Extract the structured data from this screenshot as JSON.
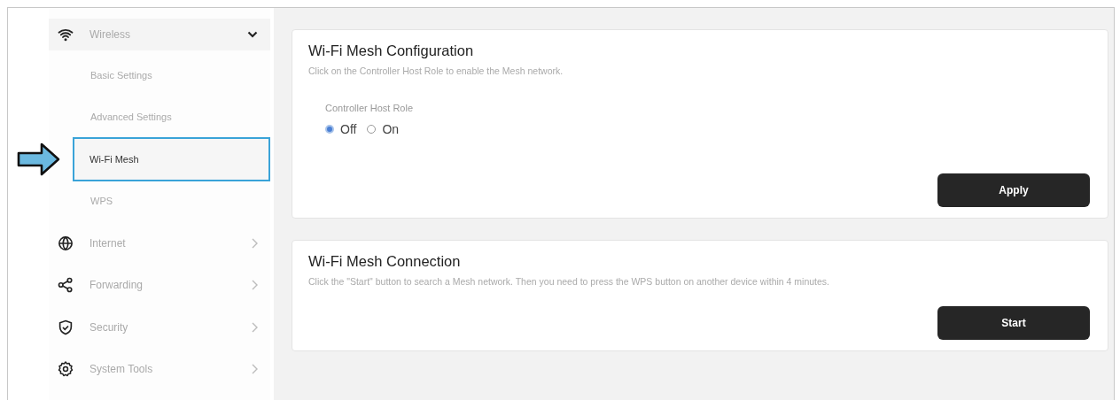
{
  "sidebar": {
    "items": [
      {
        "label": "Wireless",
        "kind": "wifi",
        "expanded": true,
        "children": [
          {
            "label": "Basic Settings",
            "selected": false
          },
          {
            "label": "Advanced Settings",
            "selected": false
          },
          {
            "label": "Wi-Fi Mesh",
            "selected": true
          },
          {
            "label": "WPS",
            "selected": false
          }
        ]
      },
      {
        "label": "Internet",
        "kind": "globe",
        "expanded": false
      },
      {
        "label": "Forwarding",
        "kind": "share",
        "expanded": false
      },
      {
        "label": "Security",
        "kind": "shield",
        "expanded": false
      },
      {
        "label": "System Tools",
        "kind": "gear",
        "expanded": false
      }
    ]
  },
  "cards": [
    {
      "title": "Wi-Fi Mesh Configuration",
      "description": "Click on the Controller Host Role to enable the Mesh network.",
      "field_label": "Controller Host Role",
      "options": [
        {
          "label": "Off",
          "selected": true
        },
        {
          "label": "On",
          "selected": false
        }
      ],
      "button": "Apply"
    },
    {
      "title": "Wi-Fi Mesh Connection",
      "description": "Click the \"Start\" button to search a Mesh network. Then you need to press the WPS button on another device within 4 minutes.",
      "button": "Start"
    }
  ]
}
